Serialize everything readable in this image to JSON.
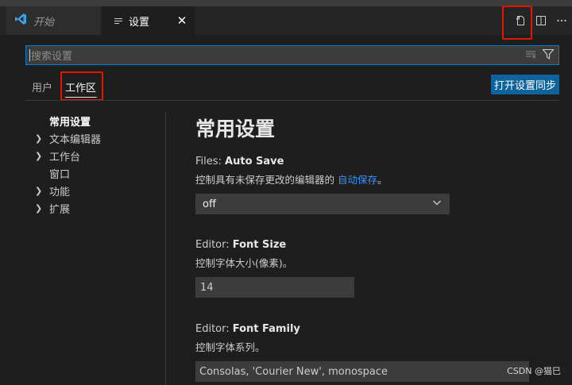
{
  "tabs": {
    "start_label": "开始",
    "settings_label": "设置",
    "close_glyph": "✕"
  },
  "search": {
    "placeholder": "搜索设置"
  },
  "scopes": {
    "user": "用户",
    "workspace": "工作区"
  },
  "sync_button": "打开设置同步",
  "toc": [
    {
      "label": "常用设置",
      "expandable": false,
      "active": true
    },
    {
      "label": "文本编辑器",
      "expandable": true,
      "active": false
    },
    {
      "label": "工作台",
      "expandable": true,
      "active": false
    },
    {
      "label": "窗口",
      "expandable": false,
      "active": false
    },
    {
      "label": "功能",
      "expandable": true,
      "active": false
    },
    {
      "label": "扩展",
      "expandable": true,
      "active": false
    }
  ],
  "section_title": "常用设置",
  "settings": {
    "auto_save": {
      "category": "Files: ",
      "name": "Auto Save",
      "desc_before": "控制具有未保存更改的编辑器的 ",
      "link": "自动保存",
      "desc_after": "。",
      "value": "off"
    },
    "font_size": {
      "category": "Editor: ",
      "name": "Font Size",
      "desc": "控制字体大小(像素)。",
      "value": "14"
    },
    "font_family": {
      "category": "Editor: ",
      "name": "Font Family",
      "desc": "控制字体系列。",
      "value": "Consolas, 'Courier New', monospace"
    }
  },
  "icons": {
    "vscode": "vscode-logo-icon",
    "open_json": "open-settings-json-icon",
    "split": "split-editor-icon",
    "more": "more-actions-icon",
    "clear": "clear-filter-icon",
    "filter": "filter-icon"
  },
  "colors": {
    "accent": "#007fd4",
    "button": "#0e639c",
    "highlight": "#e51400",
    "link": "#3794ff"
  },
  "watermark": "CSDN @猫巳"
}
